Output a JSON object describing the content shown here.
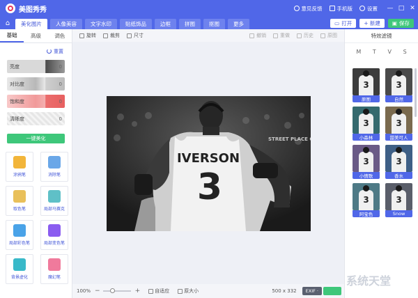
{
  "window": {
    "app_title": "美图秀秀",
    "links": [
      {
        "label": "意见反馈",
        "icon": "feedback-icon"
      },
      {
        "label": "手机版",
        "icon": "phone-icon"
      },
      {
        "label": "设置",
        "icon": "gear-icon"
      }
    ],
    "controls": [
      "—",
      "□",
      "✕"
    ]
  },
  "nav": {
    "tabs": [
      "美化图片",
      "人像美容",
      "文字水印",
      "贴纸饰品",
      "边框",
      "拼图",
      "抠图",
      "更多"
    ],
    "active_tab": 0,
    "open_label": "打开",
    "new_label": "+ 新建",
    "save_label": "保存"
  },
  "left_panel": {
    "subtabs": [
      "基础",
      "高级",
      "调色"
    ],
    "reset_label": "重置",
    "sliders": [
      {
        "label": "亮度",
        "value": "0"
      },
      {
        "label": "对比度",
        "value": "0"
      },
      {
        "label": "饱和度",
        "value": "0"
      },
      {
        "label": "清晰度",
        "value": "0"
      }
    ],
    "one_click_label": "一键美化",
    "tools": [
      {
        "label": "涂鸦笔",
        "color": "#f2b53a"
      },
      {
        "label": "消除笔",
        "color": "#6aa7e8"
      },
      {
        "label": "取色笔",
        "color": "#e9c05a"
      },
      {
        "label": "局部马赛克",
        "color": "#5fc0c7"
      },
      {
        "label": "局部彩色笔",
        "color": "#4aa3e8"
      },
      {
        "label": "局部变色笔",
        "color": "#8a5cf0"
      },
      {
        "label": "背景虚化",
        "color": "#39b9c9"
      },
      {
        "label": "魔幻笔",
        "color": "#f07a9c"
      }
    ]
  },
  "toolbar": {
    "items": [
      {
        "label": "旋转",
        "enabled": true
      },
      {
        "label": "裁剪",
        "enabled": true
      },
      {
        "label": "尺寸",
        "enabled": true
      }
    ],
    "history": [
      {
        "label": "撤销"
      },
      {
        "label": "重做"
      },
      {
        "label": "历史"
      },
      {
        "label": "原图"
      }
    ]
  },
  "photo": {
    "jersey_name": "IVERSON",
    "jersey_number": "3",
    "banner_text": "STREET PLACE ON EARTH"
  },
  "status": {
    "zoom": "100%",
    "zoom_level": 0.3,
    "fit_label": "自适应",
    "actual_label": "原大小",
    "dimensions": "500 x 332",
    "exif_label": "EXIF ·"
  },
  "right_panel": {
    "title": "特效滤镜",
    "categories": [
      "M",
      "T",
      "V",
      "S"
    ],
    "filters": [
      {
        "name": "原图",
        "tint": "#3c3c3c"
      },
      {
        "name": "自然",
        "tint": "#4a4a4a"
      },
      {
        "name": "小森林",
        "tint": "#356a6e"
      },
      {
        "name": "甜美可人",
        "tint": "#7a6a4e"
      },
      {
        "name": "小情歌",
        "tint": "#6a5a86"
      },
      {
        "name": "香水",
        "tint": "#3e5f86"
      },
      {
        "name": "阿宝色",
        "tint": "#4e7a86"
      },
      {
        "name": "Snow",
        "tint": "#5a5e6a"
      }
    ]
  },
  "watermark": "系统天堂"
}
